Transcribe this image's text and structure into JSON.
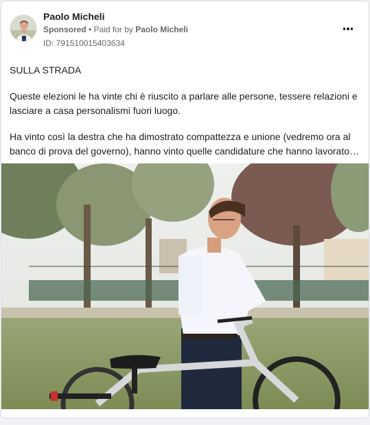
{
  "post": {
    "author": "Paolo Micheli",
    "sponsored_label": "Sponsored",
    "separator": " • ",
    "paid_for_prefix": "Paid for by ",
    "paid_for_name": "Paolo Micheli",
    "ad_id": "ID: 791510015403634",
    "menu_icon": "more-options-icon",
    "paragraphs": [
      "SULLA STRADA",
      "Queste elezioni le ha vinte chi è riuscito a parlare alle persone, tessere relazioni e lasciare a casa personalismi fuori luogo.",
      "Ha vinto così la destra che ha dimostrato compattezza e unione (vedremo ora al banco di prova del governo), hanno vinto quelle candidature che hanno lavorato…"
    ]
  },
  "colors": {
    "page_background": "#f0f2f5",
    "card_background": "#ffffff",
    "primary_text": "#1c1e21",
    "secondary_text": "#65676b"
  }
}
